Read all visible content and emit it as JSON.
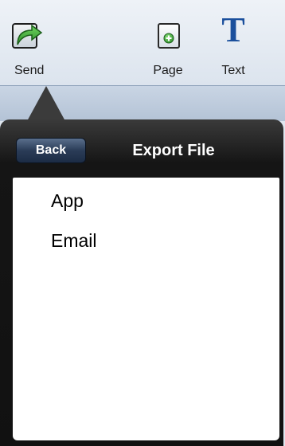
{
  "toolbar": {
    "send_label": "Send",
    "page_label": "Page",
    "text_label": "Text",
    "text_glyph": "T",
    "icons": {
      "send": "share-arrow-icon",
      "page": "add-page-icon",
      "text": "text-tool-icon"
    }
  },
  "popover": {
    "back_label": "Back",
    "title": "Export File",
    "items": [
      {
        "label": "App"
      },
      {
        "label": "Email"
      }
    ]
  },
  "colors": {
    "accent_blue": "#1a4f9c",
    "send_icon_green": "#3fae3a",
    "popover_dark": "#151515",
    "back_button": "#2a3c57"
  }
}
